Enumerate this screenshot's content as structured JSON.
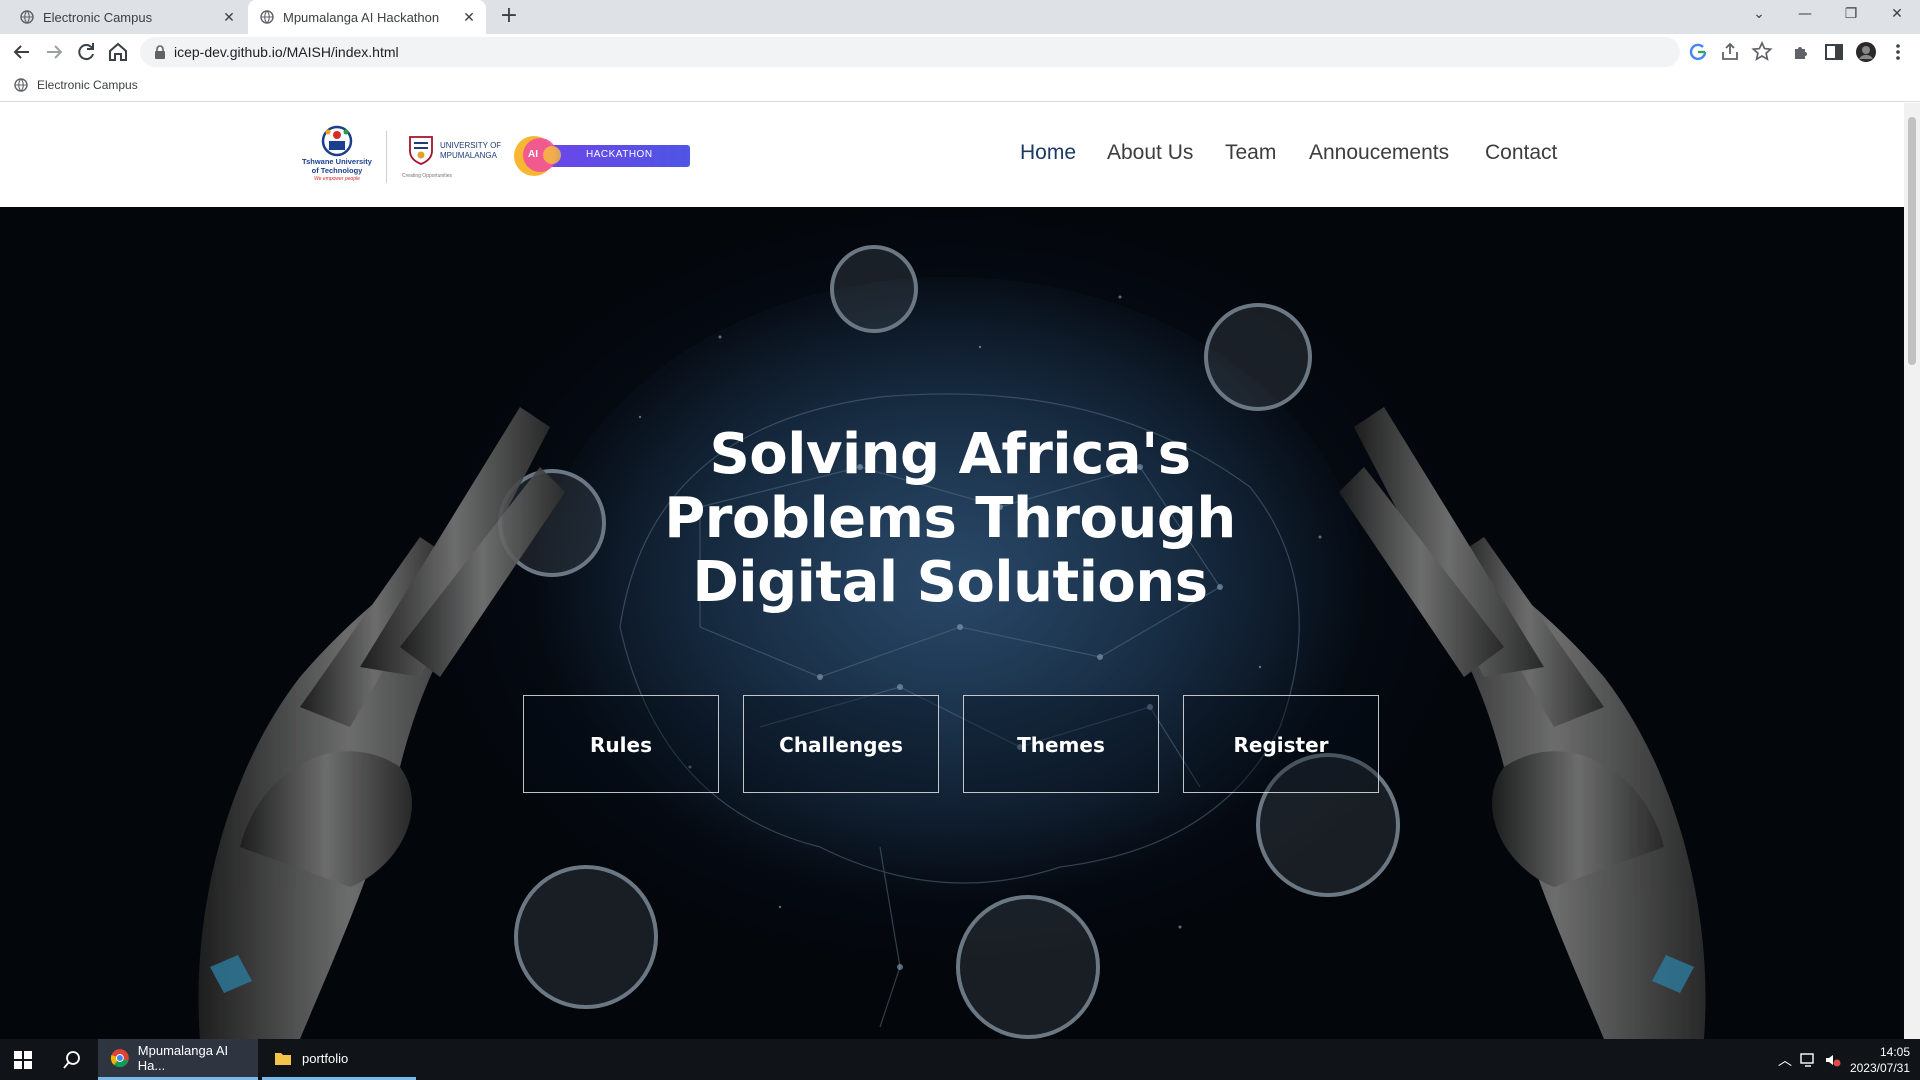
{
  "browser": {
    "tabs": [
      {
        "title": "Electronic Campus",
        "active": false
      },
      {
        "title": "Mpumalanga AI Hackathon",
        "active": true
      }
    ],
    "url": "icep-dev.github.io/MAISH/index.html",
    "bookmarks": [
      {
        "label": "Electronic Campus"
      }
    ]
  },
  "site": {
    "logos": {
      "tut_name": "Tshwane University of Technology",
      "tut_line1": "Tshwane University",
      "tut_line2": "of Technology",
      "tut_tagline": "We empower people",
      "ump_line1": "UNIVERSITY OF",
      "ump_line2": "MPUMALANGA",
      "ump_tagline": "Creating Opportunities",
      "hack_ai": "AI",
      "hack_label": "HACKATHON"
    },
    "nav": [
      {
        "label": "Home",
        "active": true
      },
      {
        "label": "About Us",
        "active": false
      },
      {
        "label": "Team",
        "active": false
      },
      {
        "label": "Annoucements",
        "active": false
      },
      {
        "label": "Contact",
        "active": false
      }
    ],
    "hero": {
      "headline_lines": [
        "Solving Africa's",
        "Problems Through",
        "Digital Solutions"
      ],
      "buttons": [
        {
          "label": "Rules"
        },
        {
          "label": "Challenges"
        },
        {
          "label": "Themes"
        },
        {
          "label": "Register"
        }
      ]
    }
  },
  "taskbar": {
    "apps": [
      {
        "label": "Mpumalanga AI Ha...",
        "icon": "chrome-icon"
      },
      {
        "label": "portfolio",
        "icon": "folder-icon"
      }
    ],
    "time": "14:05",
    "date": "2023/07/31"
  },
  "colors": {
    "nav_active": "#1c3a66",
    "hero_bg": "#0a1626",
    "hackathon_badge": "#4f55e6"
  }
}
